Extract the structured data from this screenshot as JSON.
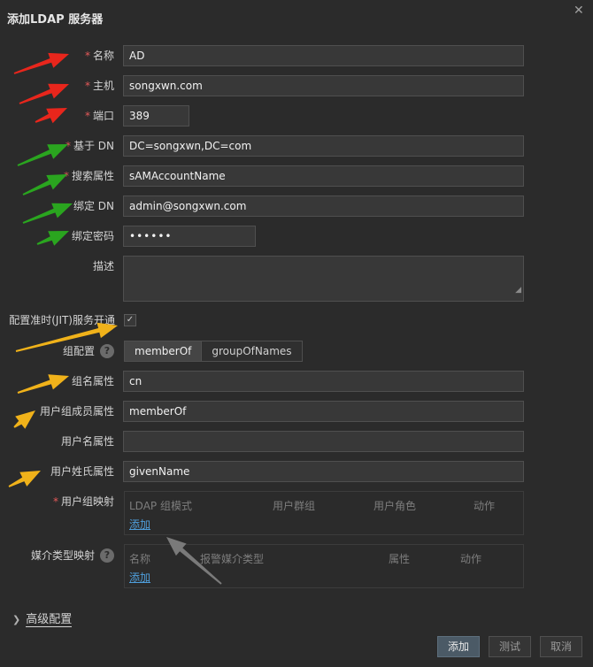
{
  "dialog": {
    "title": "添加LDAP 服务器"
  },
  "fields": {
    "name": {
      "label": "名称",
      "value": "AD"
    },
    "host": {
      "label": "主机",
      "value": "songxwn.com"
    },
    "port": {
      "label": "端口",
      "value": "389"
    },
    "base_dn": {
      "label": "基于 DN",
      "value": "DC=songxwn,DC=com"
    },
    "search_attribute": {
      "label": "搜索属性",
      "value": "sAMAccountName"
    },
    "bind_dn": {
      "label": "绑定 DN",
      "value": "admin@songxwn.com"
    },
    "bind_password": {
      "label": "绑定密码",
      "value": "••••••"
    },
    "description": {
      "label": "描述",
      "value": ""
    },
    "jit": {
      "label": "配置准时(JIT)服务开通",
      "checked": true,
      "mark": "✓"
    },
    "group_config": {
      "label": "组配置",
      "options": [
        "memberOf",
        "groupOfNames"
      ],
      "selected": "memberOf"
    },
    "group_name_attr": {
      "label": "组名属性",
      "value": "cn"
    },
    "user_group_member_attr": {
      "label": "用户组成员属性",
      "value": "memberOf"
    },
    "username_attr": {
      "label": "用户名属性",
      "value": ""
    },
    "user_surname_attr": {
      "label": "用户姓氏属性",
      "value": "givenName"
    }
  },
  "user_group_mapping": {
    "label": "用户组映射",
    "columns": [
      "LDAP 组模式",
      "用户群组",
      "用户角色",
      "动作"
    ],
    "add_link": "添加"
  },
  "media_type_mapping": {
    "label": "媒介类型映射",
    "columns": [
      "名称",
      "报警媒介类型",
      "属性",
      "动作"
    ],
    "add_link": "添加"
  },
  "advanced": {
    "label": "高级配置"
  },
  "buttons": {
    "add": "添加",
    "test": "测试",
    "cancel": "取消"
  },
  "help_mark": "?",
  "required_mark": "*",
  "close_mark": "✕",
  "annotation_colors": {
    "red": "#e8261c",
    "green": "#2aa51f",
    "yellow": "#f0b21a",
    "gray": "#7a7a7a"
  }
}
